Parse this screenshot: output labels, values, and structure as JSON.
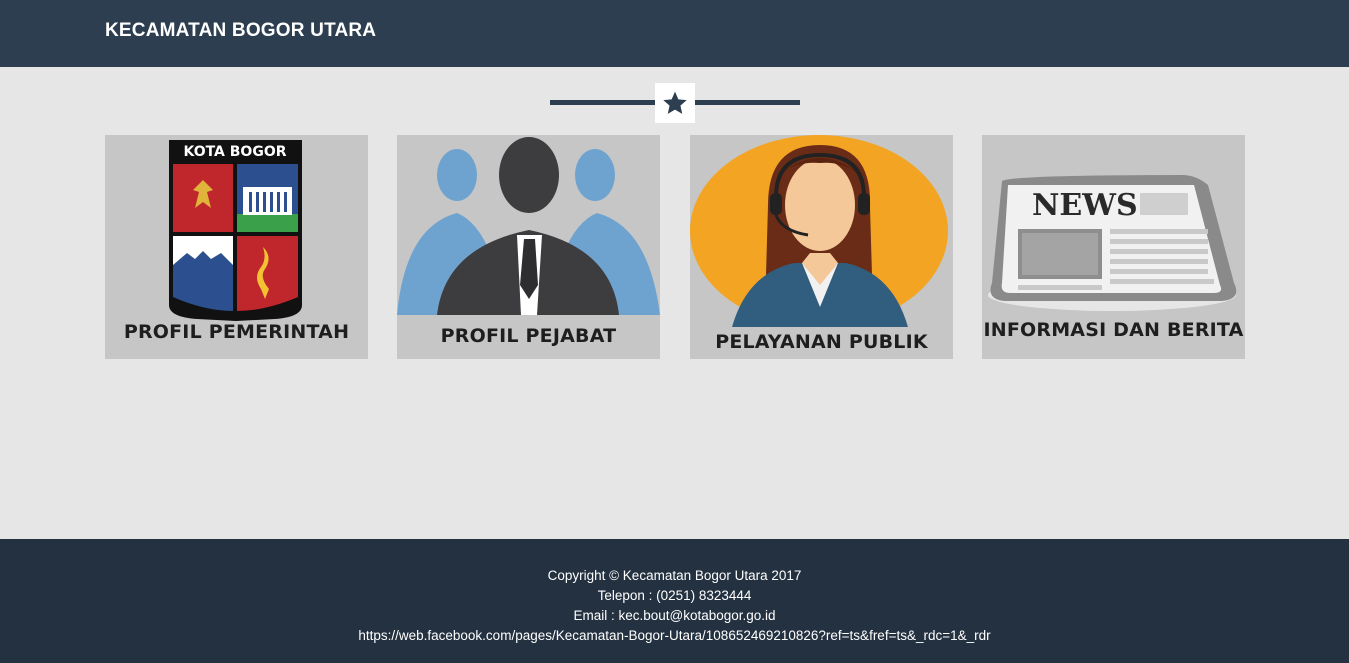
{
  "header": {
    "brand": "KECAMATAN BOGOR UTARA"
  },
  "divider": {
    "icon": "star-icon"
  },
  "cards": [
    {
      "caption": "PROFIL PEMERINTAH",
      "image_badge": "KOTA BOGOR"
    },
    {
      "caption": "PROFIL PEJABAT"
    },
    {
      "caption": "PELAYANAN PUBLIK"
    },
    {
      "caption": "INFORMASI DAN BERITA",
      "image_badge": "NEWS"
    }
  ],
  "footer": {
    "copyright": "Copyright © Kecamatan Bogor Utara 2017",
    "telepon": "Telepon : (0251) 8323444",
    "email": "Email : kec.bout@kotabogor.go.id",
    "facebook": "https://web.facebook.com/pages/Kecamatan-Bogor-Utara/108652469210826?ref=ts&fref=ts&_rdc=1&_rdr"
  },
  "colors": {
    "navbar": "#2c3e50",
    "footer": "#233140",
    "background": "#e6e6e6"
  }
}
